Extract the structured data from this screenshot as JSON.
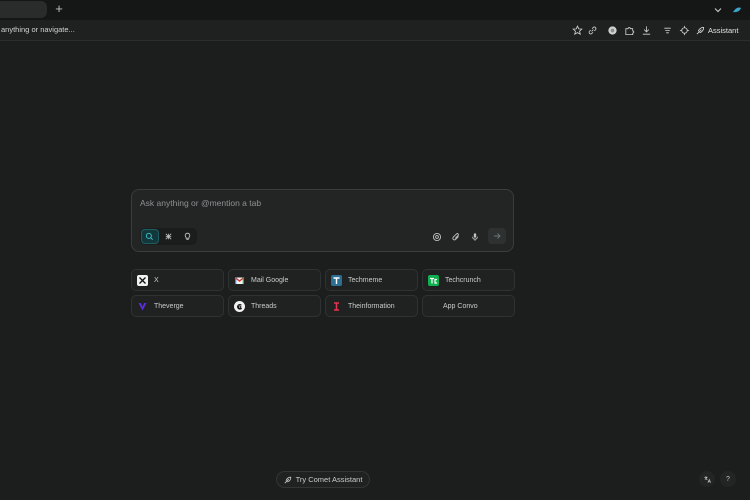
{
  "tabbar": {
    "new_tab_glyph": "+"
  },
  "address_bar": {
    "url_text": "anything or navigate...",
    "assistant_label": "Assistant"
  },
  "search": {
    "placeholder": "Ask anything or @mention a tab"
  },
  "shortcuts": [
    {
      "label": "X",
      "icon": "x-logo-icon"
    },
    {
      "label": "Mail Google",
      "icon": "gmail-icon"
    },
    {
      "label": "Techmeme",
      "icon": "techmeme-icon"
    },
    {
      "label": "Techcrunch",
      "icon": "techcrunch-icon"
    },
    {
      "label": "Theverge",
      "icon": "theverge-icon"
    },
    {
      "label": "Threads",
      "icon": "threads-icon"
    },
    {
      "label": "Theinformation",
      "icon": "theinformation-icon"
    },
    {
      "label": "App Convo",
      "icon": ""
    }
  ],
  "footer": {
    "comet_label": "Try Comet Assistant",
    "help_glyph": "?"
  },
  "colors": {
    "background": "#1c1d1d",
    "accent_teal": "#1e5e63",
    "techcrunch_green": "#0fb04f",
    "verge_purple": "#5b2de0",
    "theinformation_red": "#e0364f"
  }
}
